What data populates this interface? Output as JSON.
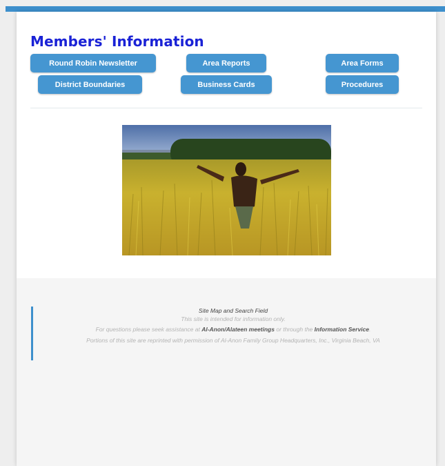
{
  "page": {
    "title": "Members' Information",
    "colors": {
      "accent": "#3d8fcc",
      "button": "#4596d1",
      "title": "#1a22d6",
      "footer_bg": "#f5f5f5"
    }
  },
  "nav": {
    "round_robin": "Round Robin Newsletter",
    "area_reports": "Area Reports",
    "area_forms": "Area Forms",
    "district_boundaries": "District Boundaries",
    "business_cards": "Business Cards",
    "procedures": "Procedures"
  },
  "footer": {
    "site_map": "Site Map and Search Field",
    "info_only": "This site is intended for information only.",
    "questions_prefix": "For questions please seek assistance at ",
    "meetings_link": "Al-Anon/Alateen meetings",
    "questions_mid": " or through the ",
    "info_service_link": "Information Service",
    "questions_suffix": ".",
    "permission": "Portions of this site are reprinted with permission of Al-Anon Family Group Headquarters, Inc., Virginia Beach, VA"
  }
}
